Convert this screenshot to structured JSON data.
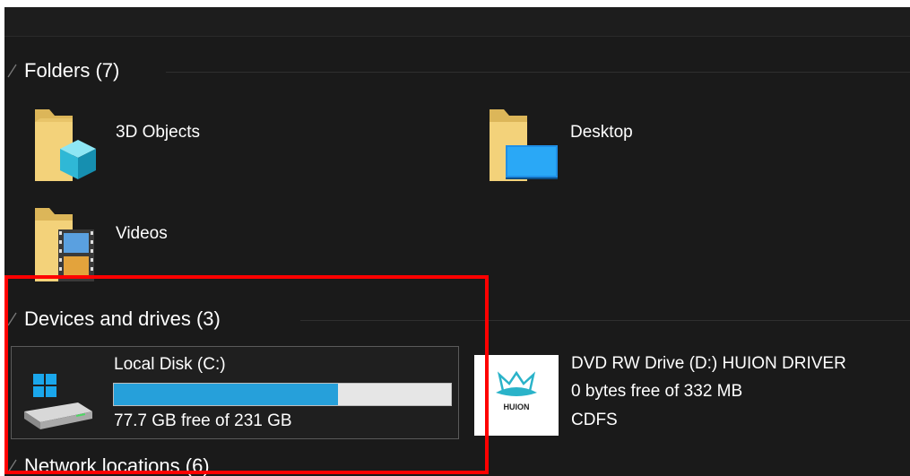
{
  "groups": {
    "folders": {
      "title": "Folders (7)"
    },
    "devices": {
      "title": "Devices and drives (3)"
    },
    "network": {
      "title": "Network locations (6)"
    }
  },
  "folders": [
    {
      "label": "3D Objects",
      "icon": "folder-3d-objects-icon"
    },
    {
      "label": "Desktop",
      "icon": "folder-desktop-icon"
    },
    {
      "label": "Videos",
      "icon": "folder-videos-icon"
    }
  ],
  "drives": [
    {
      "name": "Local Disk (C:)",
      "free_text": "77.7 GB free of 231 GB",
      "used_fraction": 0.664,
      "icon": "windows-hard-drive-icon"
    },
    {
      "name": "DVD RW Drive (D:) HUION DRIVER",
      "free_text": "0 bytes free of 332 MB",
      "filesystem": "CDFS",
      "icon": "huion-logo-icon"
    }
  ],
  "colors": {
    "background": "#1a1a1a",
    "text": "#ffffff",
    "progress_fill": "#26a0da",
    "progress_track": "#e6e6e6",
    "highlight": "#ff0000"
  }
}
